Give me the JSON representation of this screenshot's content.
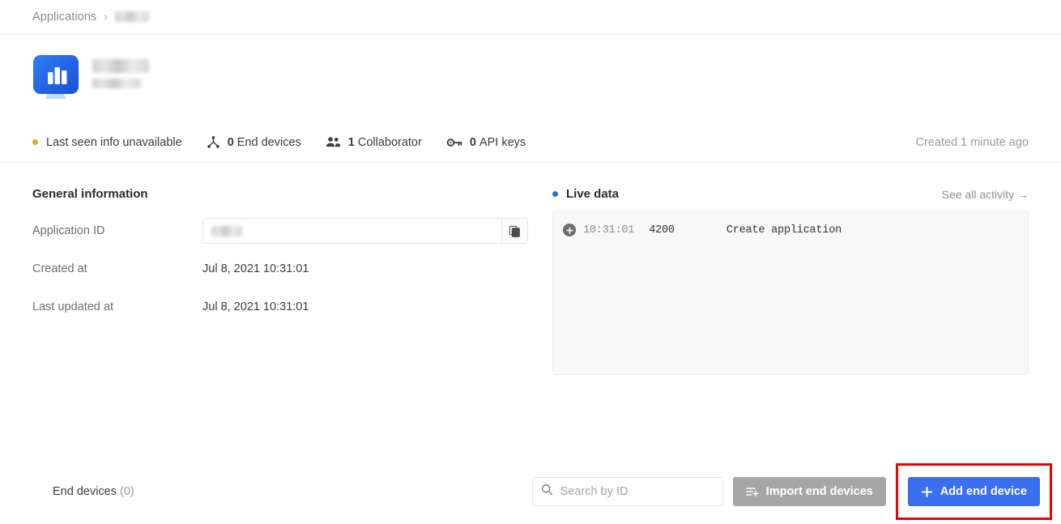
{
  "breadcrumb": {
    "root": "Applications",
    "separator": "›",
    "current_redacted": true
  },
  "app_header": {
    "icon": "application-monitor-chart-icon",
    "name_redacted": true,
    "subtitle_redacted": true
  },
  "status": {
    "last_seen": "Last seen info unavailable",
    "last_seen_dot_color": "#eaa72c",
    "items": [
      {
        "icon": "end-devices-hierarchy-icon",
        "count": "0",
        "label": "End devices"
      },
      {
        "icon": "collaborators-people-icon",
        "count": "1",
        "label": "Collaborator"
      },
      {
        "icon": "api-keys-key-icon",
        "count": "0",
        "label": "API keys"
      }
    ],
    "created": "Created 1 minute ago"
  },
  "general_information": {
    "title": "General information",
    "rows": [
      {
        "label": "Application ID",
        "value": "",
        "redacted": true,
        "type": "field"
      },
      {
        "label": "Created at",
        "value": "Jul 8, 2021 10:31:01",
        "type": "text"
      },
      {
        "label": "Last updated at",
        "value": "Jul 8, 2021 10:31:01",
        "type": "text"
      }
    ],
    "copy_icon": "copy-icon"
  },
  "live_data": {
    "title": "Live data",
    "dot_color": "#2f6dd8",
    "see_all": "See all activity →",
    "entries": [
      {
        "icon": "plus-circle-icon",
        "time": "10:31:01",
        "code": "4200",
        "description": "Create application"
      }
    ]
  },
  "bottom": {
    "end_devices_label": "End devices",
    "end_devices_count": "(0)",
    "search": {
      "icon": "search-icon",
      "placeholder": "Search by ID",
      "value": ""
    },
    "import_button": {
      "icon": "import-list-plus-icon",
      "label": "Import end devices"
    },
    "add_button": {
      "icon": "plus-icon",
      "label": "Add end device"
    }
  },
  "annotation": {
    "highlight_color": "#f00000",
    "target": "add-end-device-button"
  }
}
